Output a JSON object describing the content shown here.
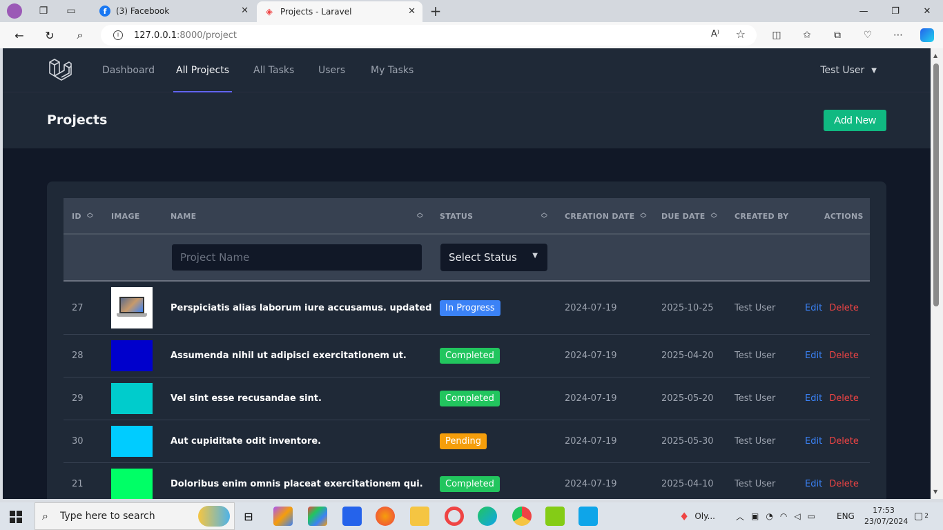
{
  "browser": {
    "tabs": [
      {
        "title": "(3) Facebook",
        "active": false
      },
      {
        "title": "Projects - Laravel",
        "active": true
      }
    ],
    "new_tab": "+",
    "url_host": "127.0.0.1",
    "url_rest": ":8000/project"
  },
  "nav": {
    "links": [
      "Dashboard",
      "All Projects",
      "All Tasks",
      "Users",
      "My Tasks"
    ],
    "active": "All Projects",
    "user": "Test User"
  },
  "header": {
    "title": "Projects",
    "add_new": "Add New"
  },
  "table": {
    "columns": [
      "ID",
      "IMAGE",
      "NAME",
      "STATUS",
      "CREATION DATE",
      "DUE DATE",
      "CREATED BY",
      "ACTIONS"
    ],
    "filter_name_placeholder": "Project Name",
    "filter_status": "Select Status",
    "rows": [
      {
        "id": "27",
        "image_color": "#ffffff",
        "name": "Perspiciatis alias laborum iure accusamus. updated",
        "status": "In Progress",
        "status_color": "#3b82f6",
        "created": "2024-07-19",
        "due": "2025-10-25",
        "by": "Test User",
        "edit": "Edit",
        "delete": "Delete"
      },
      {
        "id": "28",
        "image_color": "#0000cc",
        "name": "Assumenda nihil ut adipisci exercitationem ut.",
        "status": "Completed",
        "status_color": "#22c55e",
        "created": "2024-07-19",
        "due": "2025-04-20",
        "by": "Test User",
        "edit": "Edit",
        "delete": "Delete"
      },
      {
        "id": "29",
        "image_color": "#00cccc",
        "name": "Vel sint esse recusandae sint.",
        "status": "Completed",
        "status_color": "#22c55e",
        "created": "2024-07-19",
        "due": "2025-05-20",
        "by": "Test User",
        "edit": "Edit",
        "delete": "Delete"
      },
      {
        "id": "30",
        "image_color": "#00ccff",
        "name": "Aut cupiditate odit inventore.",
        "status": "Pending",
        "status_color": "#f59e0b",
        "created": "2024-07-19",
        "due": "2025-05-30",
        "by": "Test User",
        "edit": "Edit",
        "delete": "Delete"
      },
      {
        "id": "21",
        "image_color": "#00ff66",
        "name": "Doloribus enim omnis placeat exercitationem qui.",
        "status": "Completed",
        "status_color": "#22c55e",
        "created": "2024-07-19",
        "due": "2025-04-10",
        "by": "Test User",
        "edit": "Edit",
        "delete": "Delete"
      }
    ]
  },
  "taskbar": {
    "search_placeholder": "Type here to search",
    "weather": "Oly...",
    "lang": "ENG",
    "time": "17:53",
    "date": "23/07/2024",
    "notifications": "2"
  }
}
